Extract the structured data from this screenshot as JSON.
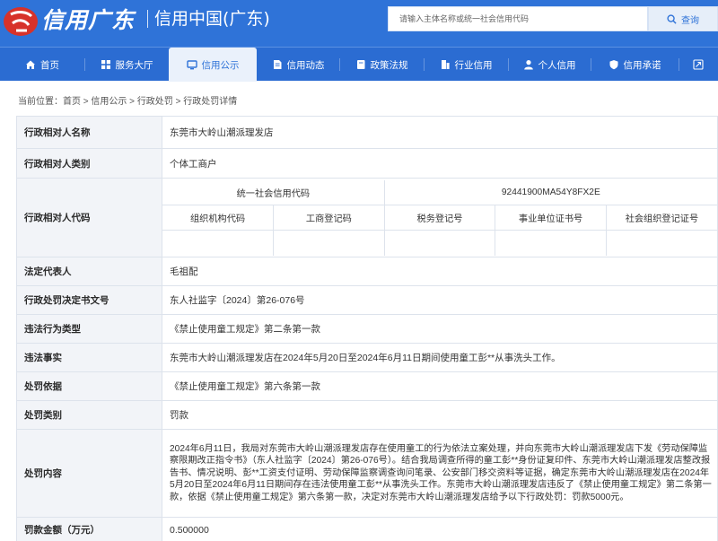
{
  "header": {
    "logo_script": "信用广东",
    "logo_text": "信用中国(广东)",
    "search_placeholder": "请输入主体名称或统一社会信用代码",
    "search_button": "查询",
    "colors": {
      "primary": "#2f73d8",
      "logo_red": "#d7322a"
    }
  },
  "nav": {
    "items": [
      {
        "label": "首页",
        "icon": "home-icon"
      },
      {
        "label": "服务大厅",
        "icon": "grid-icon"
      },
      {
        "label": "信用公示",
        "icon": "monitor-icon"
      },
      {
        "label": "信用动态",
        "icon": "document-icon"
      },
      {
        "label": "政策法规",
        "icon": "book-icon"
      },
      {
        "label": "行业信用",
        "icon": "building-icon"
      },
      {
        "label": "个人信用",
        "icon": "user-icon"
      },
      {
        "label": "信用承诺",
        "icon": "shield-icon"
      }
    ],
    "active_index": 2,
    "expand_icon": "expand-icon"
  },
  "breadcrumb": {
    "prefix": "当前位置：",
    "items": [
      "首页",
      "信用公示",
      "行政处罚",
      "行政处罚详情"
    ],
    "separator": " > "
  },
  "detail": {
    "name_label": "行政相对人名称",
    "name_value": "东莞市大岭山潮派理发店",
    "type_label": "行政相对人类别",
    "type_value": "个体工商户",
    "code_label": "行政相对人代码",
    "code": {
      "uscc_label": "统一社会信用代码",
      "uscc_value": "92441900MA54Y8FX2E",
      "sub_labels": [
        "组织机构代码",
        "工商登记码",
        "税务登记号",
        "事业单位证书号",
        "社会组织登记证号"
      ],
      "sub_values": [
        "",
        "",
        "",
        "",
        ""
      ]
    },
    "rep_label": "法定代表人",
    "rep_value": "毛祖配",
    "doc_label": "行政处罚决定书文号",
    "doc_value": "东人社监字〔2024〕第26-076号",
    "violation_type_label": "违法行为类型",
    "violation_type_value": "《禁止使用童工规定》第二条第一款",
    "facts_label": "违法事实",
    "facts_value": "东莞市大岭山潮派理发店在2024年5月20日至2024年6月11日期间使用童工彭**从事洗头工作。",
    "basis_label": "处罚依据",
    "basis_value": "《禁止使用童工规定》第六条第一款",
    "category_label": "处罚类别",
    "category_value": "罚款",
    "content_label": "处罚内容",
    "content_value": "2024年6月11日，我局对东莞市大岭山潮派理发店存在使用童工的行为依法立案处理，并向东莞市大岭山潮派理发店下发《劳动保障监察限期改正指令书》（东人社监字〔2024〕第26-076号）。结合我局调查所得的童工彭**身份证复印件、东莞市大岭山潮派理发店整改报告书、情况说明、彭**工资支付证明、劳动保障监察调查询问笔录、公安部门移交资料等证据，确定东莞市大岭山潮派理发店在2024年5月20日至2024年6月11日期间存在违法使用童工彭**从事洗头工作。东莞市大岭山潮派理发店违反了《禁止使用童工规定》第二条第一款，依据《禁止使用童工规定》第六条第一款，决定对东莞市大岭山潮派理发店给予以下行政处罚：罚款5000元。",
    "amount_label": "罚款金额（万元）",
    "amount_value": "0.500000"
  }
}
